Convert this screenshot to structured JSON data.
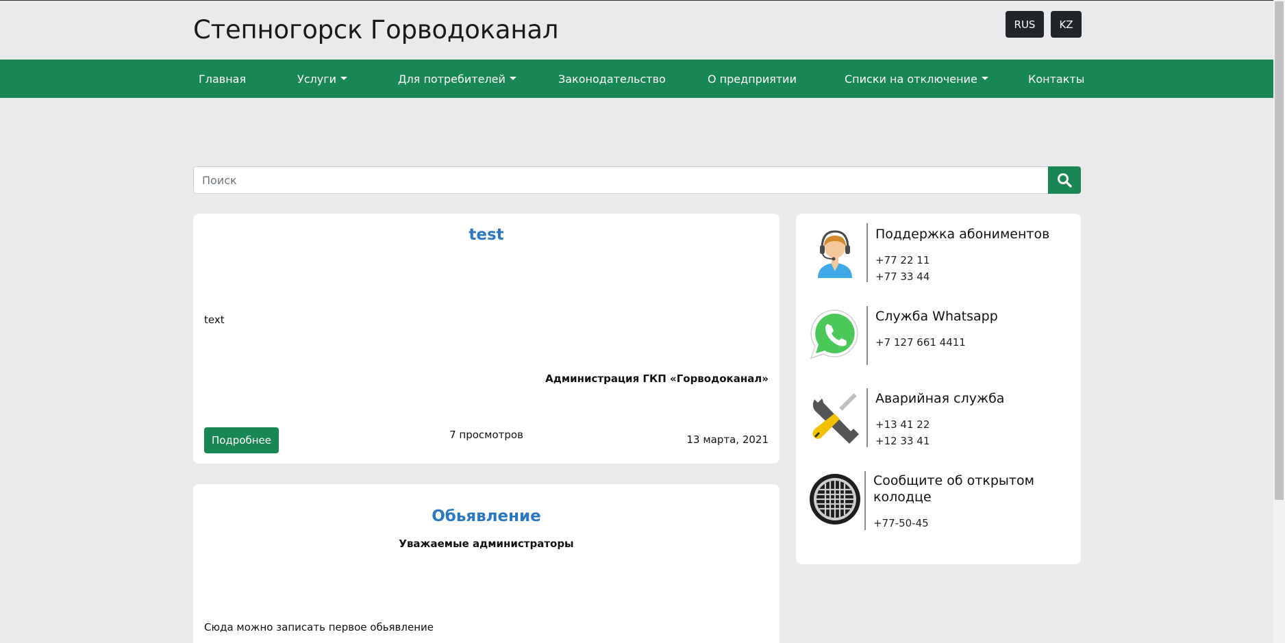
{
  "header": {
    "brand": "Степногорск Горводоканал",
    "languages": [
      "RUS",
      "KZ"
    ]
  },
  "nav": {
    "items": [
      {
        "label": "Главная",
        "dropdown": false
      },
      {
        "label": "Услуги",
        "dropdown": true
      },
      {
        "label": "Для потребителей",
        "dropdown": true
      },
      {
        "label": "Законодательство",
        "dropdown": false
      },
      {
        "label": "О предприятии",
        "dropdown": false
      },
      {
        "label": "Списки на отключение",
        "dropdown": true
      },
      {
        "label": "Контакты",
        "dropdown": false
      }
    ]
  },
  "search": {
    "placeholder": "Поиск",
    "icon": "search-icon"
  },
  "posts": [
    {
      "title": "test",
      "text": "text",
      "signature": "Администрация ГКП «Горводоканал»",
      "more_label": "Подробнее",
      "views": "7 просмотров",
      "date": "13 марта, 2021"
    },
    {
      "title": "Обьявление",
      "subtitle": "Уважаемые администраторы",
      "text": "Сюда можно записать первое обьявление"
    }
  ],
  "services": [
    {
      "icon": "operator-headset-icon",
      "title": "Поддержка абониментов",
      "lines": [
        "+77 22 11",
        "+77 33 44"
      ]
    },
    {
      "icon": "whatsapp-icon",
      "title": "Служба Whatsapp",
      "lines": [
        "+7 127 661 4411"
      ]
    },
    {
      "icon": "wrench-screwdriver-icon",
      "title": "Аварийная служба",
      "lines": [
        "+13 41 22",
        "+12 33 41"
      ]
    },
    {
      "icon": "manhole-icon",
      "title": "Сообщите об открытом колодце",
      "title_lines": [
        "Сообщите об открытом",
        "колодце"
      ],
      "lines": [
        "+77-50-45"
      ]
    }
  ],
  "colors": {
    "navbar": "#198754",
    "accent_title": "#2b78c2",
    "page_bg": "#e9eaec"
  }
}
